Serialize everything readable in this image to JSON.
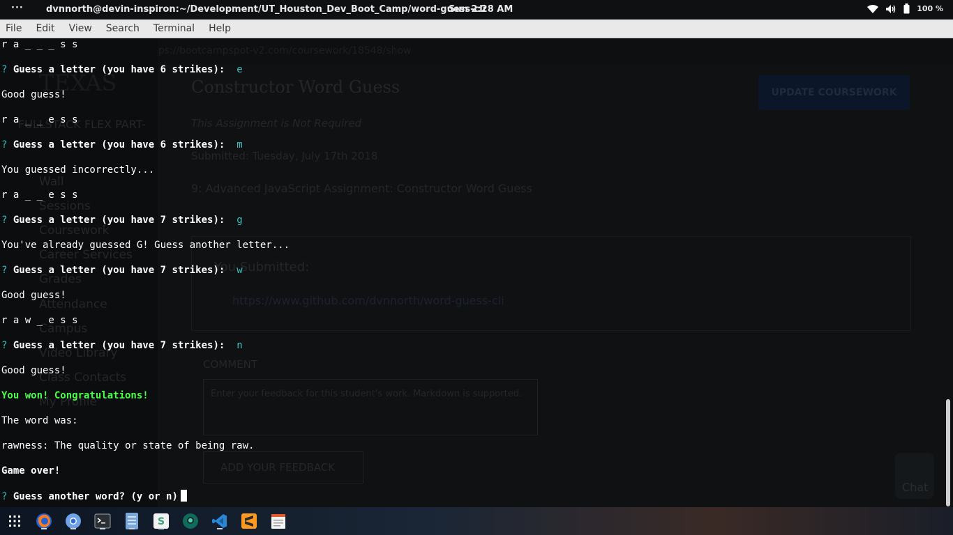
{
  "topbar": {
    "dots": "···",
    "window_title": "dvnnorth@devin-inspiron:~/Development/UT_Houston_Dev_Boot_Camp/word-guess-cli",
    "clock": "Sun  2:28 AM",
    "battery": "100 %"
  },
  "menubar": {
    "items": [
      "File",
      "Edit",
      "View",
      "Search",
      "Terminal",
      "Help"
    ]
  },
  "background": {
    "url": "https://bootcampspot-v2.com/coursework/18548/show",
    "assignment_title": "Constructor Word Guess",
    "update_button": "UPDATE COURSEWORK",
    "not_required": "This Assignment is Not Required",
    "submitted": "Submitted: Tuesday, July 17th 2018",
    "assignment_heading": "9: Advanced JavaScript Assignment: Constructor Word Guess",
    "you_submitted": "You Submitted:",
    "repo_link": "https://www.github.com/dvnnorth/word-guess-cli",
    "comment_label": "COMMENT",
    "comment_placeholder": "Enter your feedback for this student's work. Markdown is supported.",
    "feedback_button": "ADD YOUR FEEDBACK",
    "chat_label": "Chat",
    "logo": "TEXAS",
    "program": "FULLSTACK FLEX PART-",
    "sidebar_items": [
      "Wall",
      "Sessions",
      "Coursework",
      "Career Services",
      "Grades",
      "Attendance",
      "Campus",
      "Video Library",
      "Class Contacts",
      "My Profile"
    ]
  },
  "terminal": {
    "lines": [
      {
        "type": "plain",
        "text": "r a _ _ _ s s"
      },
      {
        "type": "prompt",
        "mark": "?",
        "text": "Guess a letter (you have 6 strikes): ",
        "answer": "e"
      },
      {
        "type": "plain",
        "text": "Good guess!"
      },
      {
        "type": "plain",
        "text": "r a _ _ e s s"
      },
      {
        "type": "prompt",
        "mark": "?",
        "text": "Guess a letter (you have 6 strikes): ",
        "answer": "m"
      },
      {
        "type": "plain",
        "text": "You guessed incorrectly..."
      },
      {
        "type": "plain",
        "text": "r a _ _ e s s"
      },
      {
        "type": "prompt",
        "mark": "?",
        "text": "Guess a letter (you have 7 strikes): ",
        "answer": "g"
      },
      {
        "type": "plain",
        "text": "You've already guessed G! Guess another letter..."
      },
      {
        "type": "prompt",
        "mark": "?",
        "text": "Guess a letter (you have 7 strikes): ",
        "answer": "w"
      },
      {
        "type": "plain",
        "text": "Good guess!"
      },
      {
        "type": "plain",
        "text": "r a w _ e s s"
      },
      {
        "type": "prompt",
        "mark": "?",
        "text": "Guess a letter (you have 7 strikes): ",
        "answer": "n"
      },
      {
        "type": "plain",
        "text": "Good guess!"
      },
      {
        "type": "won",
        "text": "You won! Congratulations!"
      },
      {
        "type": "plain",
        "text": "The word was:"
      },
      {
        "type": "plain",
        "text": "rawness: The quality or state of being raw."
      },
      {
        "type": "bold",
        "text": "Game over!"
      },
      {
        "type": "prompt",
        "mark": "?",
        "text": "Guess another word? (y or n)",
        "answer": ""
      }
    ]
  },
  "taskbar": {
    "apps": [
      "apps-grid-icon",
      "firefox-icon",
      "chromium-icon",
      "terminal-icon",
      "files-icon",
      "slack-icon",
      "gitkraken-icon",
      "vscode-icon",
      "sublime-text-icon",
      "text-editor-icon"
    ]
  }
}
